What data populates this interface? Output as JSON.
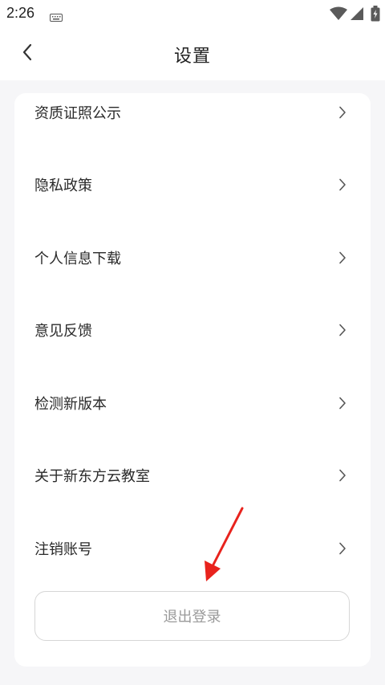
{
  "status_bar": {
    "time": "2:26"
  },
  "header": {
    "title": "设置"
  },
  "settings": {
    "items": [
      {
        "label": "资质证照公示"
      },
      {
        "label": "隐私政策"
      },
      {
        "label": "个人信息下载"
      },
      {
        "label": "意见反馈"
      },
      {
        "label": "检测新版本"
      },
      {
        "label": "关于新东方云教室"
      },
      {
        "label": "注销账号"
      }
    ],
    "logout_label": "退出登录"
  },
  "colors": {
    "background": "#f6f6f8",
    "card": "#ffffff",
    "annotation_arrow": "#e8231d",
    "logout_text": "#9a9a9a"
  }
}
